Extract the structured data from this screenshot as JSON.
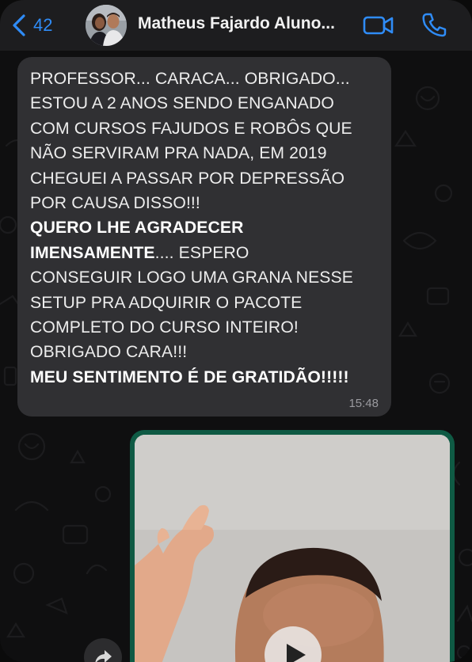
{
  "header": {
    "back_count": "42",
    "contact_name": "Matheus Fajardo Aluno...",
    "accent": "#2f8cf7"
  },
  "icons": {
    "back": "chevron-left-icon",
    "video": "video-camera-icon",
    "call": "phone-icon",
    "forward": "forward-share-icon",
    "play": "play-icon"
  },
  "incoming_message": {
    "lines": [
      {
        "text": "PROFESSOR... CARACA... OBRIGADO..."
      },
      {
        "text": "ESTOU A 2 ANOS SENDO ENGANADO"
      },
      {
        "text": "COM CURSOS FAJUDOS E ROBÔS QUE"
      },
      {
        "text": "NÃO SERVIRAM PRA NADA, EM 2019"
      },
      {
        "text": "CHEGUEI A PASSAR POR DEPRESSÃO"
      },
      {
        "text": "POR CAUSA DISSO!!!"
      },
      {
        "bold": "QUERO LHE AGRADECER"
      },
      {
        "bold": "IMENSAMENTE",
        "text": ".... ESPERO"
      },
      {
        "text": "CONSEGUIR LOGO UMA GRANA NESSE"
      },
      {
        "text": "SETUP PRA ADQUIRIR O PACOTE"
      },
      {
        "text": "COMPLETO DO CURSO INTEIRO!"
      },
      {
        "text": "OBRIGADO CARA!!!"
      },
      {
        "bold": "MEU SENTIMENTO É DE GRATIDÃO!!!!!"
      }
    ],
    "time": "15:48",
    "bubble_color": "#303033"
  },
  "outgoing_message": {
    "type": "video",
    "bubble_color": "#0f5a44"
  }
}
